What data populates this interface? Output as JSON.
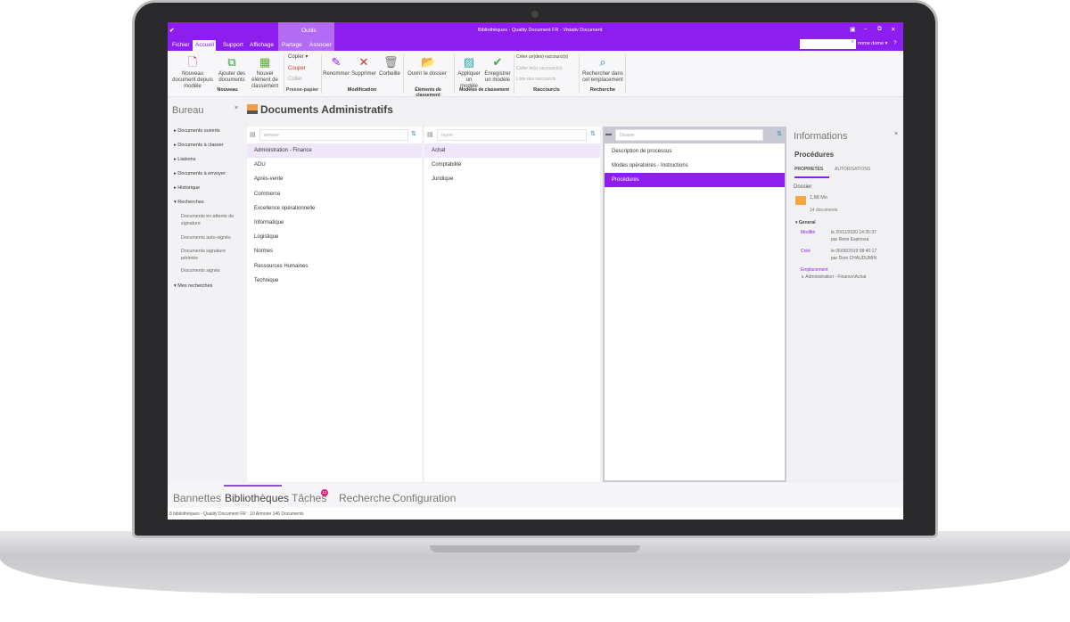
{
  "window": {
    "title": "Bibliothèques - Quality Document FR - Visiativ Document",
    "context_tab": "Outils",
    "search_placeholder": "",
    "user": "nome dome ▾"
  },
  "menu_tabs": [
    "Fichier",
    "Accueil",
    "Support",
    "Affichage",
    "Partage",
    "Associer"
  ],
  "ribbon": {
    "buttons": [
      {
        "label": "Nouveau document depuis modèle",
        "icon": "new-doc-icon"
      },
      {
        "label": "Ajouter des documents",
        "icon": "add-docs-icon"
      },
      {
        "label": "Nouvel élément de classement",
        "icon": "new-element-icon"
      },
      {
        "label": "Renommer",
        "icon": "rename-icon"
      },
      {
        "label": "Supprimer",
        "icon": "delete-icon"
      },
      {
        "label": "Corbeille",
        "icon": "trash-icon"
      },
      {
        "label": "Ouvrir le dossier",
        "icon": "folder-open-icon"
      },
      {
        "label": "Appliquer un modèle",
        "icon": "apply-template-icon"
      },
      {
        "label": "Enregistrer un modèle",
        "icon": "save-template-icon"
      },
      {
        "label": "Rechercher dans cet emplacement",
        "icon": "search-icon"
      }
    ],
    "clipboard": [
      "Copier ▾",
      "Couper",
      "Coller"
    ],
    "shortcuts": [
      "Créer un(des) raccourci(s)",
      "Coller le(s) raccourci(s)",
      "Liste des raccourcis"
    ],
    "groups": [
      "Nouveau",
      "Presse-papier",
      "Modification",
      "Éléments de classement",
      "Modèles de classement",
      "Raccourcis",
      "Recherche"
    ]
  },
  "sidebar": {
    "title": "Bureau",
    "items": [
      "Documents ouverts",
      "Documents à classer",
      "Liaisons",
      "Documents à envoyer",
      "Historique",
      "Recherches"
    ],
    "sub_items": [
      "Documents en attente de signature",
      "Documents auto-signés",
      "Documents signature périmée",
      "Documents signés"
    ],
    "last": "Mes recherches"
  },
  "main": {
    "title": "Documents Administratifs",
    "col1": {
      "placeholder": "armoire",
      "items": [
        "Administration - Finance",
        "ADU",
        "Après-vente",
        "Commerce",
        "Excellence opérationnelle",
        "Informatique",
        "Logistique",
        "Normes",
        "Ressources Humaines",
        "Technique"
      ]
    },
    "col2": {
      "placeholder": "rayon",
      "items": [
        "Achat",
        "Comptabilité",
        "Juridique"
      ]
    },
    "col3": {
      "placeholder": "Dossier",
      "items": [
        "Description de processus",
        "Modes opératoires - Instructions",
        "Procédures"
      ]
    }
  },
  "info": {
    "title": "Informations",
    "name": "Procédures",
    "tabs": [
      "PROPRIETES",
      "AUTORISATIONS"
    ],
    "type": "Dossier",
    "size": "1,88 Mo",
    "count": "14 documents",
    "section": "▾ General",
    "modified_label": "Modifié",
    "modified_value": "le 20/11/2020 14:35:37",
    "modified_by": "par Rémi Espinosa",
    "created_label": "Créé",
    "created_value": "le 06/06/2019 08:40:17",
    "created_by": "par Dom CHAUDUMIN",
    "location_label": "Emplacement",
    "location_value": "↳ Administration - Finance\\Achat"
  },
  "bottom_tabs": [
    "Bannettes",
    "Bibliothèques",
    "Tâches",
    "Recherche",
    "Configuration"
  ],
  "tasks_badge": "12",
  "status": "8 bibliothèques - Quality Document FR : 10 Armoire 146 Documents",
  "colors": {
    "accent": "#8e1df0"
  }
}
